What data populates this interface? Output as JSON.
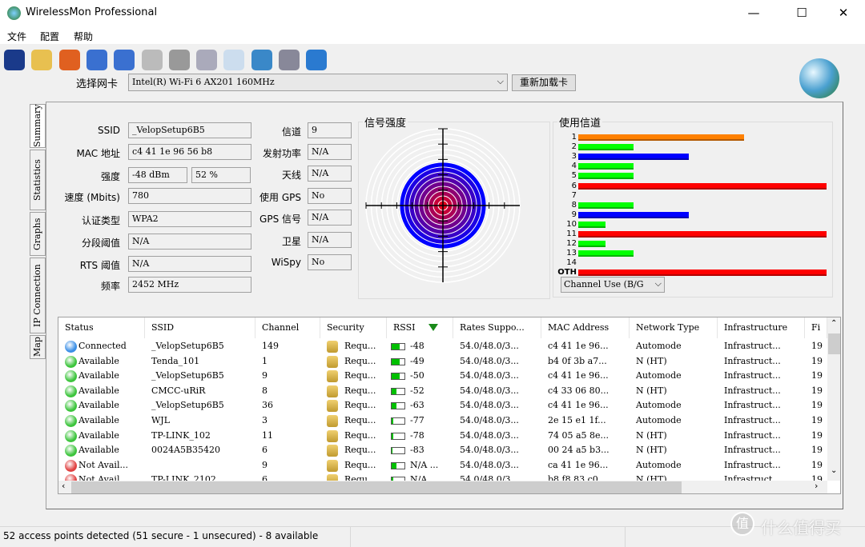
{
  "window": {
    "title": "WirelessMon Professional",
    "minimize": "—",
    "maximize": "☐",
    "close": "✕"
  },
  "menu": [
    "文件",
    "配置",
    "帮助"
  ],
  "toolbar": [
    "save-icon",
    "open-folder-icon",
    "target-icon",
    "connect-icon",
    "disconnect-icon",
    "play-log-icon",
    "stop-log-icon",
    "sign-icon",
    "checklist-icon",
    "globe-icon",
    "info-bubble-icon",
    "help-icon"
  ],
  "nic": {
    "label": "选择网卡",
    "value": "Intel(R) Wi-Fi 6 AX201 160MHz",
    "reload": "重新加载卡"
  },
  "side_tabs": [
    "Summary",
    "Statistics",
    "Graphs",
    "IP Connection",
    "Map"
  ],
  "summary": {
    "left": [
      {
        "label": "SSID",
        "value": "_VelopSetup6B5"
      },
      {
        "label": "MAC 地址",
        "value": "c4 41 1e 96 56 b8"
      },
      {
        "label": "强度",
        "value": "-48 dBm",
        "value2": "52 %"
      },
      {
        "label": "速度 (Mbits)",
        "value": "780"
      },
      {
        "label": "认证类型",
        "value": "WPA2"
      },
      {
        "label": "分段阈值",
        "value": "N/A"
      },
      {
        "label": "RTS 阈值",
        "value": "N/A"
      },
      {
        "label": "频率",
        "value": "2452 MHz"
      }
    ],
    "right": [
      {
        "label": "信道",
        "value": "9"
      },
      {
        "label": "发射功率",
        "value": "N/A"
      },
      {
        "label": "天线",
        "value": "N/A"
      },
      {
        "label": "使用 GPS",
        "value": "No"
      },
      {
        "label": "GPS 信号",
        "value": "N/A"
      },
      {
        "label": "卫星",
        "value": "N/A"
      },
      {
        "label": "WiSpy",
        "value": "No"
      }
    ]
  },
  "signal": {
    "title": "信号强度",
    "percent": 52
  },
  "channels": {
    "title": "使用信道",
    "select": "Channel Use (B/G",
    "items": [
      {
        "ch": "1",
        "count": 6,
        "color": "#ff8000"
      },
      {
        "ch": "2",
        "count": 2,
        "color": "#00ff00"
      },
      {
        "ch": "3",
        "count": 4,
        "color": "#0000ff"
      },
      {
        "ch": "4",
        "count": 2,
        "color": "#00ff00"
      },
      {
        "ch": "5",
        "count": 2,
        "color": "#00ff00"
      },
      {
        "ch": "6",
        "count": 9,
        "color": "#ff0000"
      },
      {
        "ch": "7",
        "count": 0,
        "color": "#00ff00"
      },
      {
        "ch": "8",
        "count": 2,
        "color": "#00ff00"
      },
      {
        "ch": "9",
        "count": 4,
        "color": "#0000ff"
      },
      {
        "ch": "10",
        "count": 1,
        "color": "#00ff00"
      },
      {
        "ch": "11",
        "count": 9,
        "color": "#ff0000"
      },
      {
        "ch": "12",
        "count": 1,
        "color": "#00ff00"
      },
      {
        "ch": "13",
        "count": 2,
        "color": "#00ff00"
      },
      {
        "ch": "14",
        "count": 0,
        "color": "#00ff00"
      },
      {
        "ch": "OTH",
        "count": 9,
        "color": "#ff0000"
      }
    ]
  },
  "table": {
    "columns": [
      "Status",
      "SSID",
      "Channel",
      "Security",
      "RSSI",
      "Rates Suppo...",
      "MAC Address",
      "Network Type",
      "Infrastructure",
      "Fi"
    ],
    "rows": [
      {
        "status": "Connected",
        "color": "#3a8ee6",
        "ssid": "_VelopSetup6B5",
        "ch": "149",
        "sec": "Requ...",
        "bar": 0.6,
        "rssi": "-48",
        "rates": "54.0/48.0/3...",
        "mac": "c4 41 1e 96...",
        "type": "Automode",
        "infra": "Infrastruct...",
        "fi": "19"
      },
      {
        "status": "Available",
        "color": "#3cc43c",
        "ssid": "Tenda_101",
        "ch": "1",
        "sec": "Requ...",
        "bar": 0.6,
        "rssi": "-49",
        "rates": "54.0/48.0/3...",
        "mac": "b4 0f 3b a7...",
        "type": "N (HT)",
        "infra": "Infrastruct...",
        "fi": "19"
      },
      {
        "status": "Available",
        "color": "#3cc43c",
        "ssid": "_VelopSetup6B5",
        "ch": "9",
        "sec": "Requ...",
        "bar": 0.6,
        "rssi": "-50",
        "rates": "54.0/48.0/3...",
        "mac": "c4 41 1e 96...",
        "type": "Automode",
        "infra": "Infrastruct...",
        "fi": "19"
      },
      {
        "status": "Available",
        "color": "#3cc43c",
        "ssid": "CMCC-uRiR",
        "ch": "8",
        "sec": "Requ...",
        "bar": 0.4,
        "rssi": "-52",
        "rates": "54.0/48.0/3...",
        "mac": "c4 33 06 80...",
        "type": "N (HT)",
        "infra": "Infrastruct...",
        "fi": "19"
      },
      {
        "status": "Available",
        "color": "#3cc43c",
        "ssid": "_VelopSetup6B5",
        "ch": "36",
        "sec": "Requ...",
        "bar": 0.4,
        "rssi": "-63",
        "rates": "54.0/48.0/3...",
        "mac": "c4 41 1e 96...",
        "type": "Automode",
        "infra": "Infrastruct...",
        "fi": "19"
      },
      {
        "status": "Available",
        "color": "#3cc43c",
        "ssid": "WJL",
        "ch": "3",
        "sec": "Requ...",
        "bar": 0.1,
        "rssi": "-77",
        "rates": "54.0/48.0/3...",
        "mac": "2e 15 e1 1f...",
        "type": "Automode",
        "infra": "Infrastruct...",
        "fi": "19"
      },
      {
        "status": "Available",
        "color": "#3cc43c",
        "ssid": "TP-LINK_102",
        "ch": "11",
        "sec": "Requ...",
        "bar": 0.1,
        "rssi": "-78",
        "rates": "54.0/48.0/3...",
        "mac": "74 05 a5 8e...",
        "type": "N (HT)",
        "infra": "Infrastruct...",
        "fi": "19"
      },
      {
        "status": "Available",
        "color": "#3cc43c",
        "ssid": "0024A5B35420",
        "ch": "6",
        "sec": "Requ...",
        "bar": 0,
        "rssi": "-83",
        "rates": "54.0/48.0/3...",
        "mac": "00 24 a5 b3...",
        "type": "N (HT)",
        "infra": "Infrastruct...",
        "fi": "19"
      },
      {
        "status": "Not Avail...",
        "color": "#e04040",
        "ssid": "",
        "ch": "9",
        "sec": "Requ...",
        "bar": 0.4,
        "rssi": "N/A ...",
        "rates": "54.0/48.0/3...",
        "mac": "ca 41 1e 96...",
        "type": "Automode",
        "infra": "Infrastruct...",
        "fi": "19"
      },
      {
        "status": "Not Avail...",
        "color": "#e04040",
        "ssid": "TP-LINK_2102",
        "ch": "6",
        "sec": "Requ...",
        "bar": 0.1,
        "rssi": "N/A",
        "rates": "54.0/48.0/3...",
        "mac": "b8 f8 83 c0...",
        "type": "N (HT)",
        "infra": "Infrastruct...",
        "fi": "19"
      }
    ]
  },
  "status_bar": "52 access points detected (51 secure - 1 unsecured) - 8 available",
  "watermark": "什么值得买"
}
